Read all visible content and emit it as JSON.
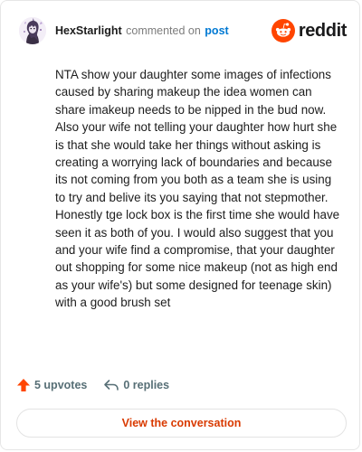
{
  "header": {
    "username": "HexStarlight",
    "action_text": "commented on",
    "post_link": "post",
    "brand": "reddit",
    "avatar_icon": "avatar-image",
    "brand_icon": "reddit-snoo-icon"
  },
  "comment": {
    "text": "NTA show your daughter some images of infections caused by sharing makeup the idea women can share imakeup needs to be nipped in the bud now. Also your wife not telling your daughter how hurt she is that she would take her things without asking is creating a worrying lack of boundaries and because its not coming from you both as a team she is using to try and belive its you saying that not stepmother. Honestly tge lock box is the first time she would have seen it as both of you. I would also suggest that you and your wife find a compromise, that your daughter out shopping for some nice makeup (not as high end as your wife's) but some designed for teenage skin) with a good brush set"
  },
  "footer": {
    "upvotes": "5 upvotes",
    "replies": "0 replies",
    "upvote_icon": "upvote-arrow-icon",
    "reply_icon": "reply-arrow-icon"
  },
  "cta": {
    "label": "View the conversation"
  },
  "colors": {
    "brand_orange": "#ff4500",
    "link_blue": "#0079d3",
    "cta_text": "#d93a00",
    "meta_gray": "#576f76"
  }
}
